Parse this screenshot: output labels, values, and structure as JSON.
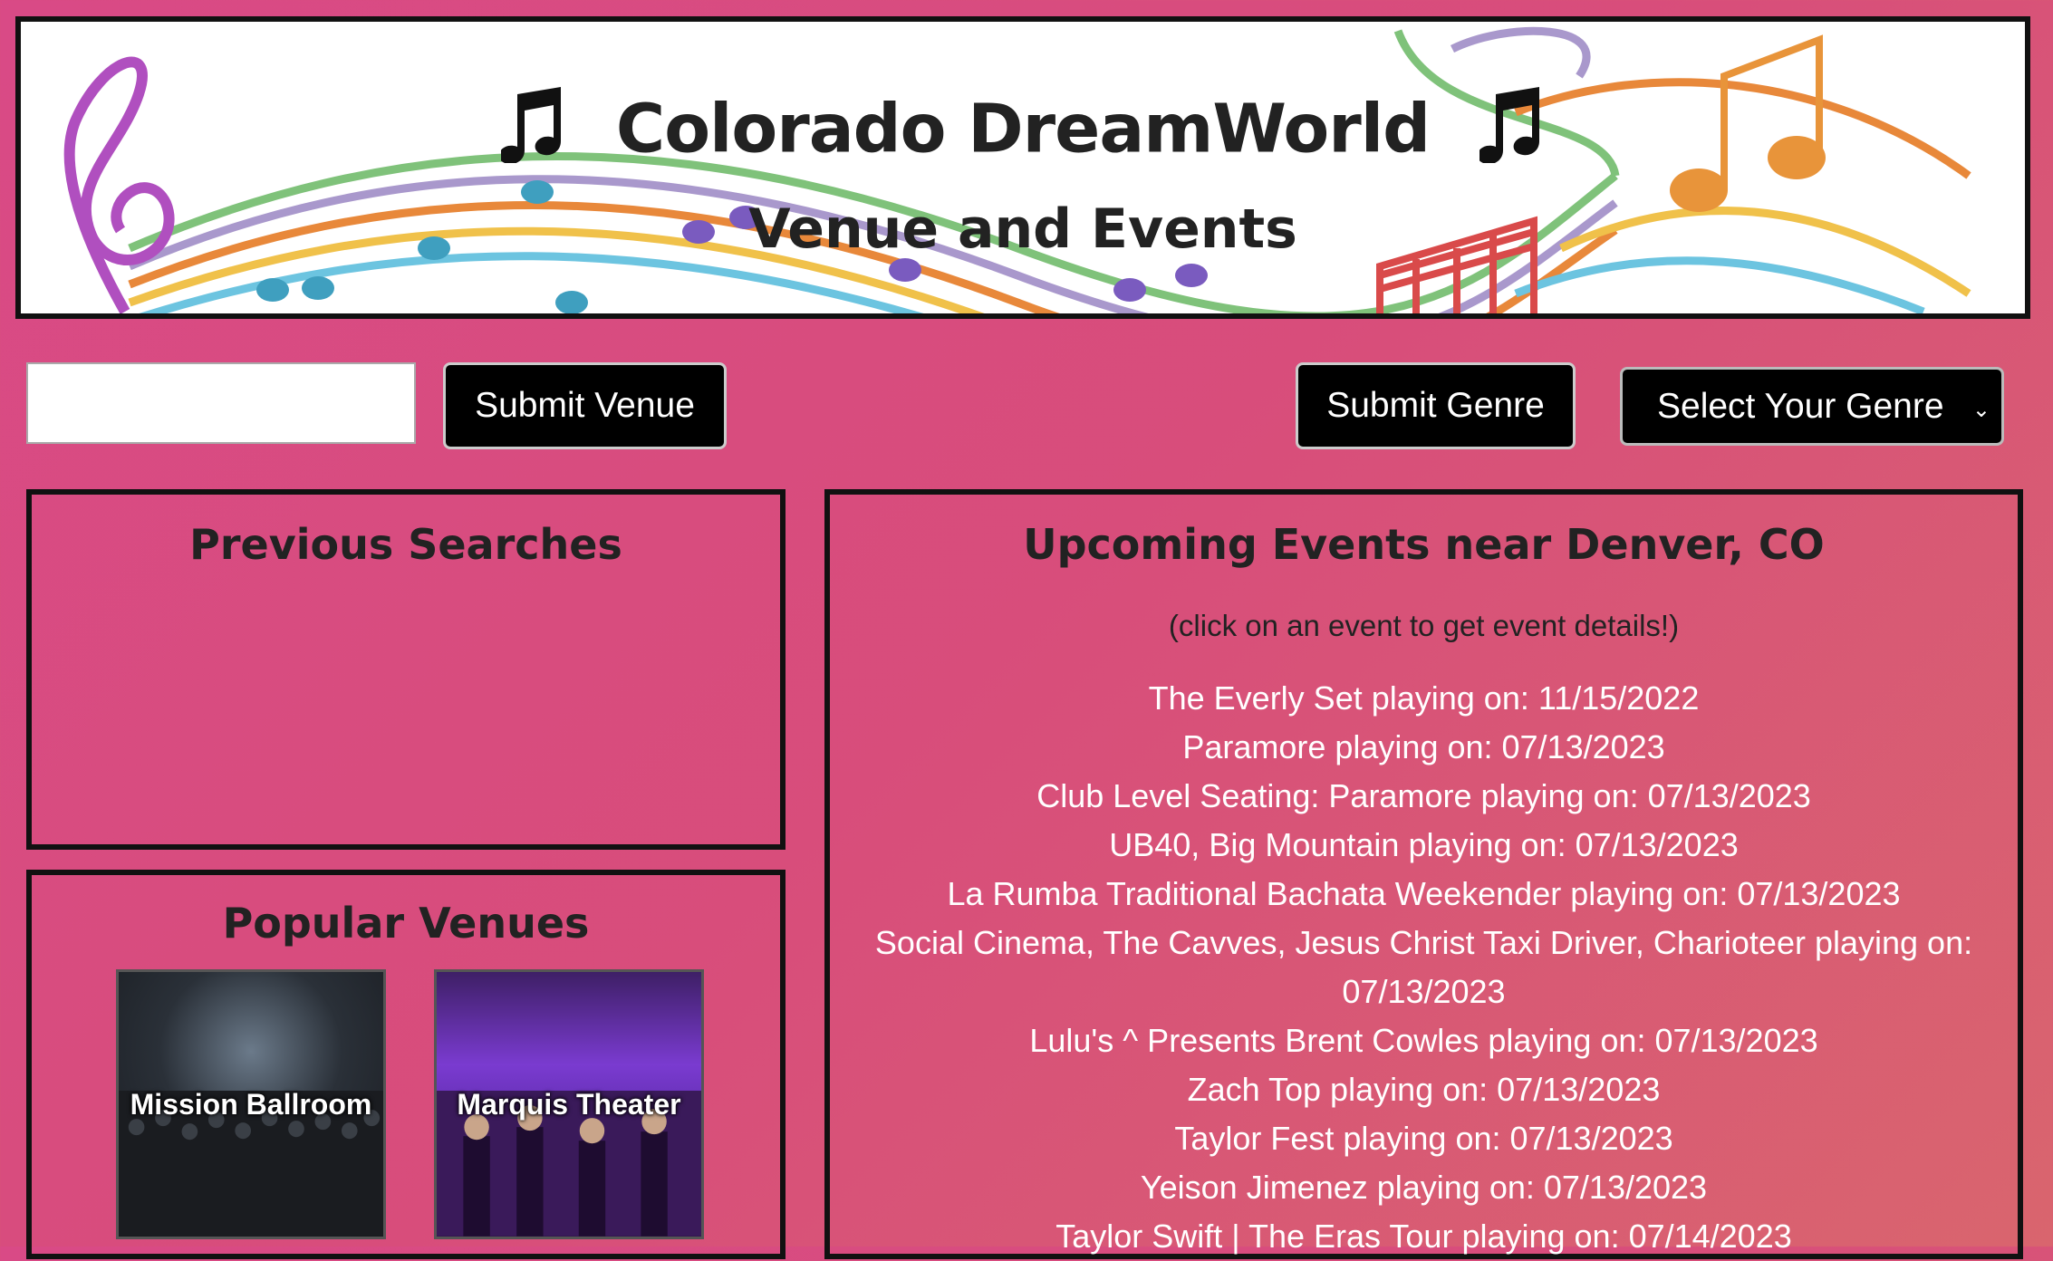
{
  "banner": {
    "title": "Colorado DreamWorld",
    "subtitle": "Venue and Events",
    "left_icon": "music-note-icon",
    "right_icon": "music-note-icon"
  },
  "search": {
    "venue_input_value": "",
    "submit_venue_label": "Submit Venue",
    "submit_genre_label": "Submit Genre",
    "genre_select_value": "Select Your Genre"
  },
  "previous_searches": {
    "title": "Previous Searches",
    "items": []
  },
  "popular_venues": {
    "title": "Popular Venues",
    "venues": [
      {
        "name": "Mission Ballroom"
      },
      {
        "name": "Marquis Theater"
      }
    ]
  },
  "events": {
    "title": "Upcoming Events near Denver, CO",
    "hint": "(click on an event to get event details!)",
    "items": [
      "The Everly Set playing on: 11/15/2022",
      "Paramore playing on: 07/13/2023",
      "Club Level Seating: Paramore playing on: 07/13/2023",
      "UB40, Big Mountain playing on: 07/13/2023",
      "La Rumba Traditional Bachata Weekender playing on: 07/13/2023",
      "Social Cinema, The Cavves, Jesus Christ Taxi Driver, Charioteer playing on: 07/13/2023",
      "Lulu's ^ Presents Brent Cowles playing on: 07/13/2023",
      "Zach Top playing on: 07/13/2023",
      "Taylor Fest playing on: 07/13/2023",
      "Yeison Jimenez playing on: 07/13/2023",
      "Taylor Swift | The Eras Tour playing on: 07/14/2023"
    ]
  },
  "colors": {
    "background_start": "#d94a86",
    "background_end": "#d9656e",
    "event_text": "#ffffff",
    "button_bg": "#000000"
  }
}
